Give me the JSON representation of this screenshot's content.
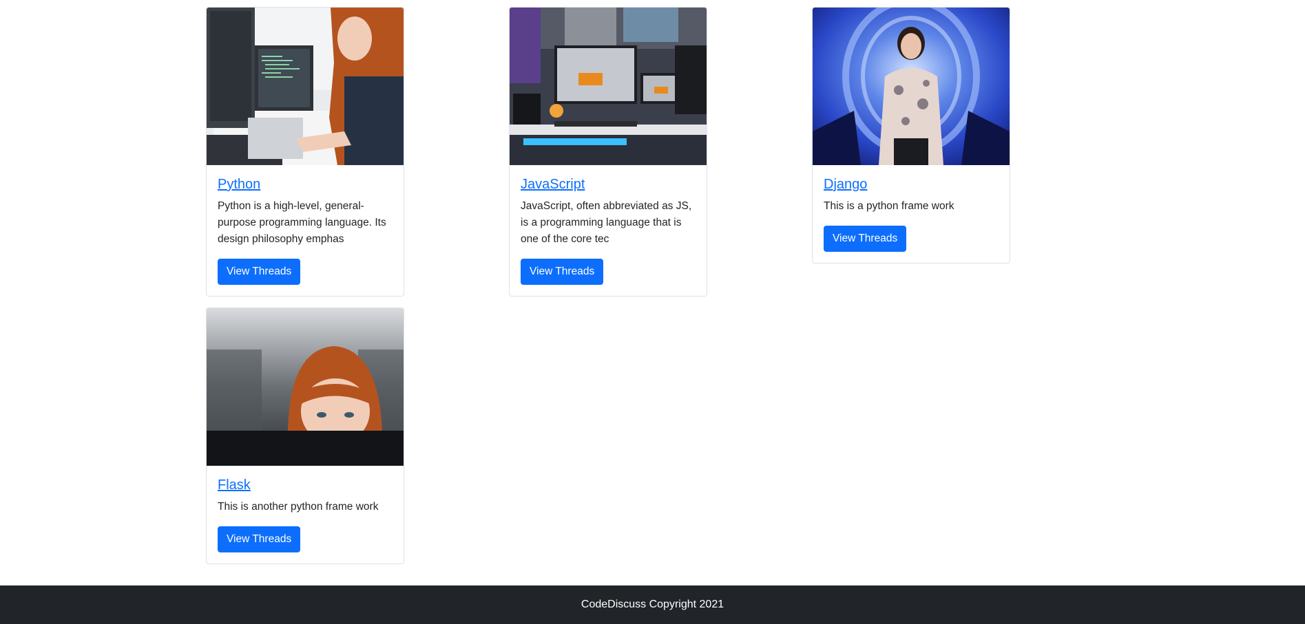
{
  "categories": [
    {
      "title": "Python",
      "description": "Python is a high-level, general-purpose programming language. Its design philosophy emphas",
      "button_label": "View Threads",
      "image_icon": "woman-at-computer-photo"
    },
    {
      "title": "JavaScript",
      "description": "JavaScript, often abbreviated as JS, is a programming language that is one of the core tec",
      "button_label": "View Threads",
      "image_icon": "desk-setup-photo"
    },
    {
      "title": "Django",
      "description": "This is a python frame work",
      "button_label": "View Threads",
      "image_icon": "woman-in-tunnel-photo"
    },
    {
      "title": "Flask",
      "description": "This is another python frame work",
      "button_label": "View Threads",
      "image_icon": "woman-behind-monitor-photo"
    }
  ],
  "footer": {
    "text": "CodeDiscuss Copyright 2021"
  },
  "colors": {
    "primary": "#0d6efd",
    "footer_bg": "#212529",
    "text": "#212529"
  }
}
